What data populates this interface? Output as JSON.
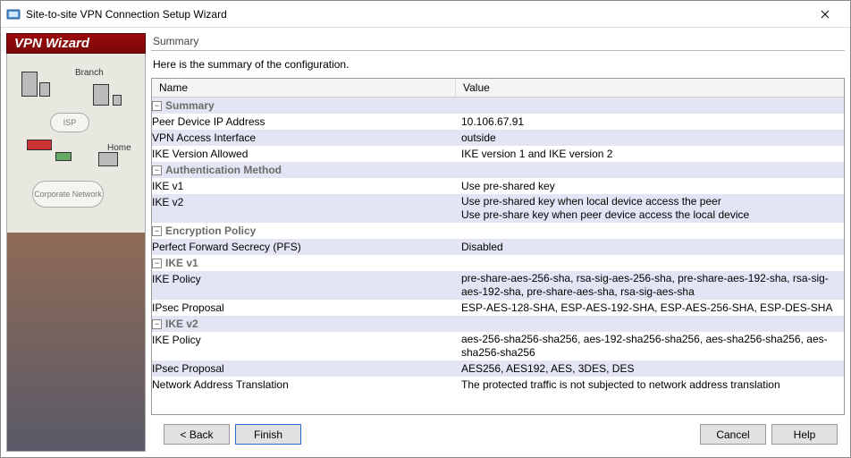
{
  "window": {
    "title": "Site-to-site VPN Connection Setup Wizard"
  },
  "sidebar": {
    "header": "VPN Wizard",
    "labels": {
      "branch": "Branch",
      "isp": "ISP",
      "home": "Home",
      "corp": "Corporate Network"
    }
  },
  "section": {
    "title": "Summary",
    "lead": "Here is the summary of the configuration."
  },
  "columns": {
    "name": "Name",
    "value": "Value"
  },
  "rows": [
    {
      "type": "group",
      "level": 0,
      "alt": true,
      "label": "Summary"
    },
    {
      "type": "item",
      "level": 1,
      "alt": false,
      "label": "Peer Device IP Address",
      "value": "10.106.67.91"
    },
    {
      "type": "item",
      "level": 1,
      "alt": true,
      "label": "VPN Access Interface",
      "value": "outside"
    },
    {
      "type": "item",
      "level": 1,
      "alt": false,
      "label": "IKE Version Allowed",
      "value": "IKE version 1 and IKE version 2"
    },
    {
      "type": "group",
      "level": 0,
      "alt": true,
      "label": "Authentication Method"
    },
    {
      "type": "item",
      "level": 1,
      "alt": false,
      "label": "IKE v1",
      "value": "Use pre-shared key"
    },
    {
      "type": "item",
      "level": 1,
      "alt": true,
      "label": "IKE v2",
      "value": "Use pre-shared key when local device access the peer\nUse pre-share key when peer device access the local device",
      "multi": true
    },
    {
      "type": "group",
      "level": 0,
      "alt": false,
      "label": "Encryption Policy"
    },
    {
      "type": "item",
      "level": 1,
      "alt": true,
      "label": "Perfect Forward Secrecy (PFS)",
      "value": "Disabled"
    },
    {
      "type": "group",
      "level": 1,
      "alt": false,
      "label": "IKE v1"
    },
    {
      "type": "item",
      "level": 2,
      "alt": true,
      "label": "IKE Policy",
      "value": "pre-share-aes-256-sha, rsa-sig-aes-256-sha, pre-share-aes-192-sha, rsa-sig-aes-192-sha, pre-share-aes-sha, rsa-sig-aes-sha",
      "multi": true
    },
    {
      "type": "item",
      "level": 2,
      "alt": false,
      "label": "IPsec Proposal",
      "value": "ESP-AES-128-SHA, ESP-AES-192-SHA, ESP-AES-256-SHA, ESP-DES-SHA"
    },
    {
      "type": "group",
      "level": 1,
      "alt": true,
      "label": "IKE v2"
    },
    {
      "type": "item",
      "level": 2,
      "alt": false,
      "label": "IKE Policy",
      "value": "aes-256-sha256-sha256, aes-192-sha256-sha256, aes-sha256-sha256, aes-sha256-sha256",
      "multi": true
    },
    {
      "type": "item",
      "level": 2,
      "alt": true,
      "label": "IPsec Proposal",
      "value": "AES256, AES192, AES, 3DES, DES"
    },
    {
      "type": "item",
      "level": 1,
      "alt": false,
      "label": "Network Address Translation",
      "value": "The protected traffic is not subjected to network address translation"
    }
  ],
  "buttons": {
    "back": "< Back",
    "finish": "Finish",
    "cancel": "Cancel",
    "help": "Help"
  }
}
